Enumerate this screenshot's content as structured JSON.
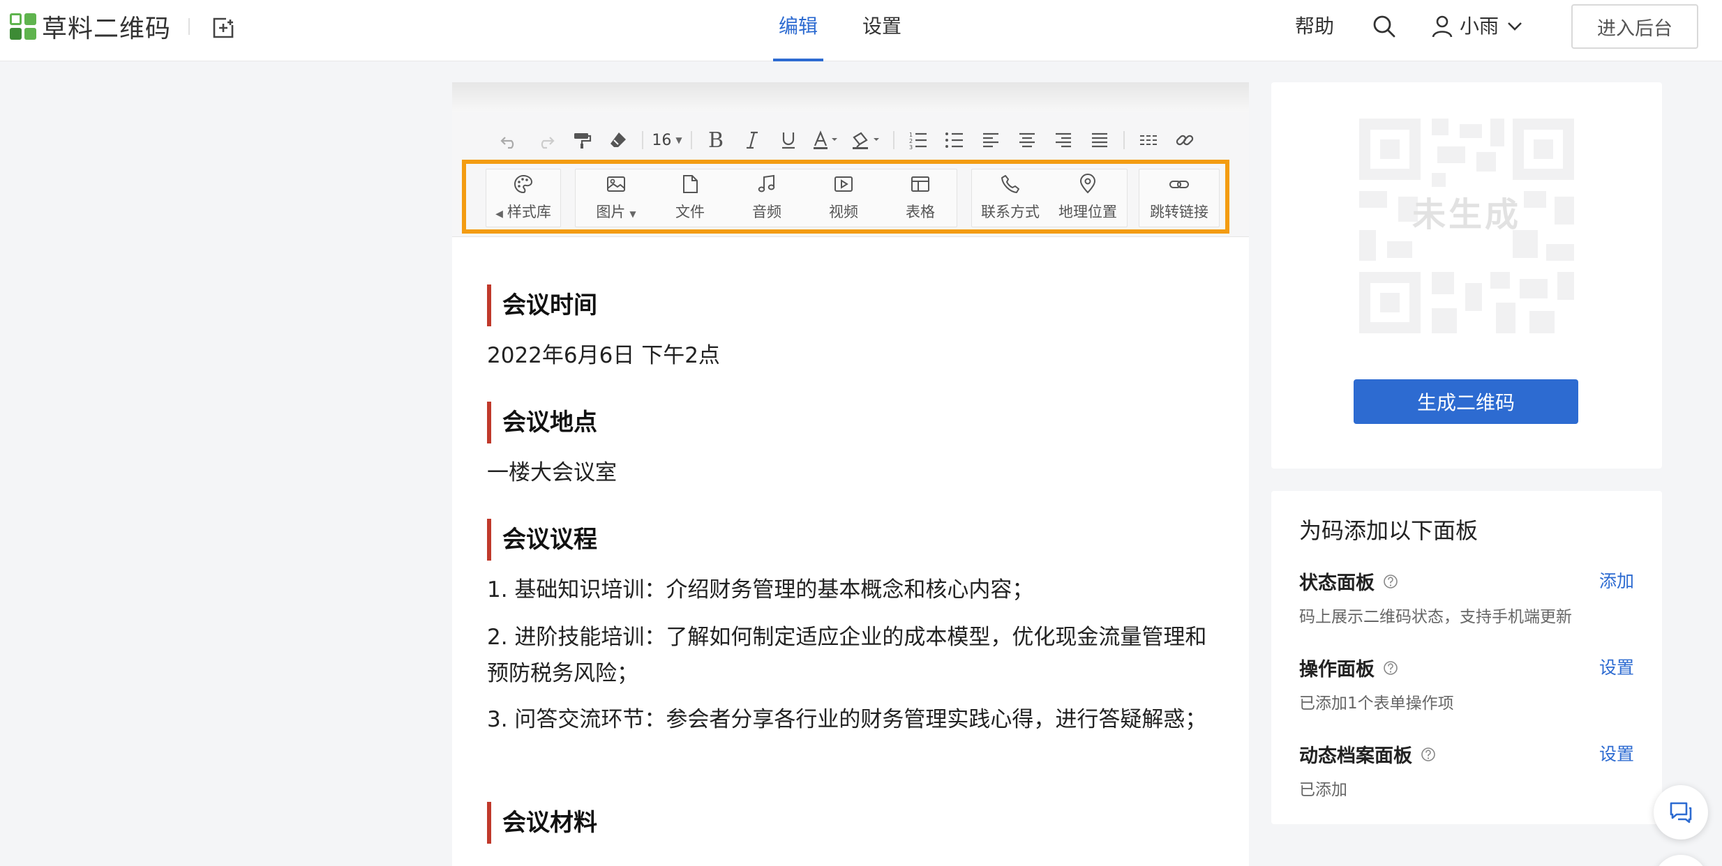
{
  "app": {
    "name": "草料二维码"
  },
  "nav": {
    "tabs": [
      {
        "label": "编辑"
      },
      {
        "label": "设置"
      }
    ]
  },
  "header": {
    "help": "帮助",
    "user_name": "小雨",
    "backend_button": "进入后台"
  },
  "toolbar": {
    "font_size": "16",
    "bold_glyph": "B",
    "insert_items": [
      {
        "label": "样式库"
      },
      {
        "label": "图片"
      },
      {
        "label": "文件"
      },
      {
        "label": "音频"
      },
      {
        "label": "视频"
      },
      {
        "label": "表格"
      },
      {
        "label": "联系方式"
      },
      {
        "label": "地理位置"
      },
      {
        "label": "跳转链接"
      }
    ]
  },
  "document": {
    "sections": [
      {
        "heading": "会议时间",
        "paragraphs": [
          "2022年6月6日 下午2点"
        ]
      },
      {
        "heading": "会议地点",
        "paragraphs": [
          "一楼大会议室"
        ]
      },
      {
        "heading": "会议议程",
        "paragraphs": [
          "1. 基础知识培训：介绍财务管理的基本概念和核心内容；",
          "2. 进阶技能培训：了解如何制定适应企业的成本模型，优化现金流量管理和预防税务风险；",
          "3. 问答交流环节：参会者分享各行业的财务管理实践心得，进行答疑解惑；"
        ]
      },
      {
        "heading": "会议材料",
        "paragraphs": []
      }
    ]
  },
  "qr": {
    "status_overlay": "未生成",
    "generate_button": "生成二维码"
  },
  "panels": {
    "title": "为码添加以下面板",
    "items": [
      {
        "name": "状态面板",
        "desc": "码上展示二维码状态，支持手机端更新",
        "action": "添加"
      },
      {
        "name": "操作面板",
        "desc": "已添加1个表单操作项",
        "action": "设置"
      },
      {
        "name": "动态档案面板",
        "desc": "已添加",
        "action": "设置"
      }
    ]
  },
  "colors": {
    "accent": "#2d6bd1",
    "heading_bar": "#c0392b",
    "highlight_frame": "#f39c12",
    "logo_green": "#5fb44e"
  }
}
